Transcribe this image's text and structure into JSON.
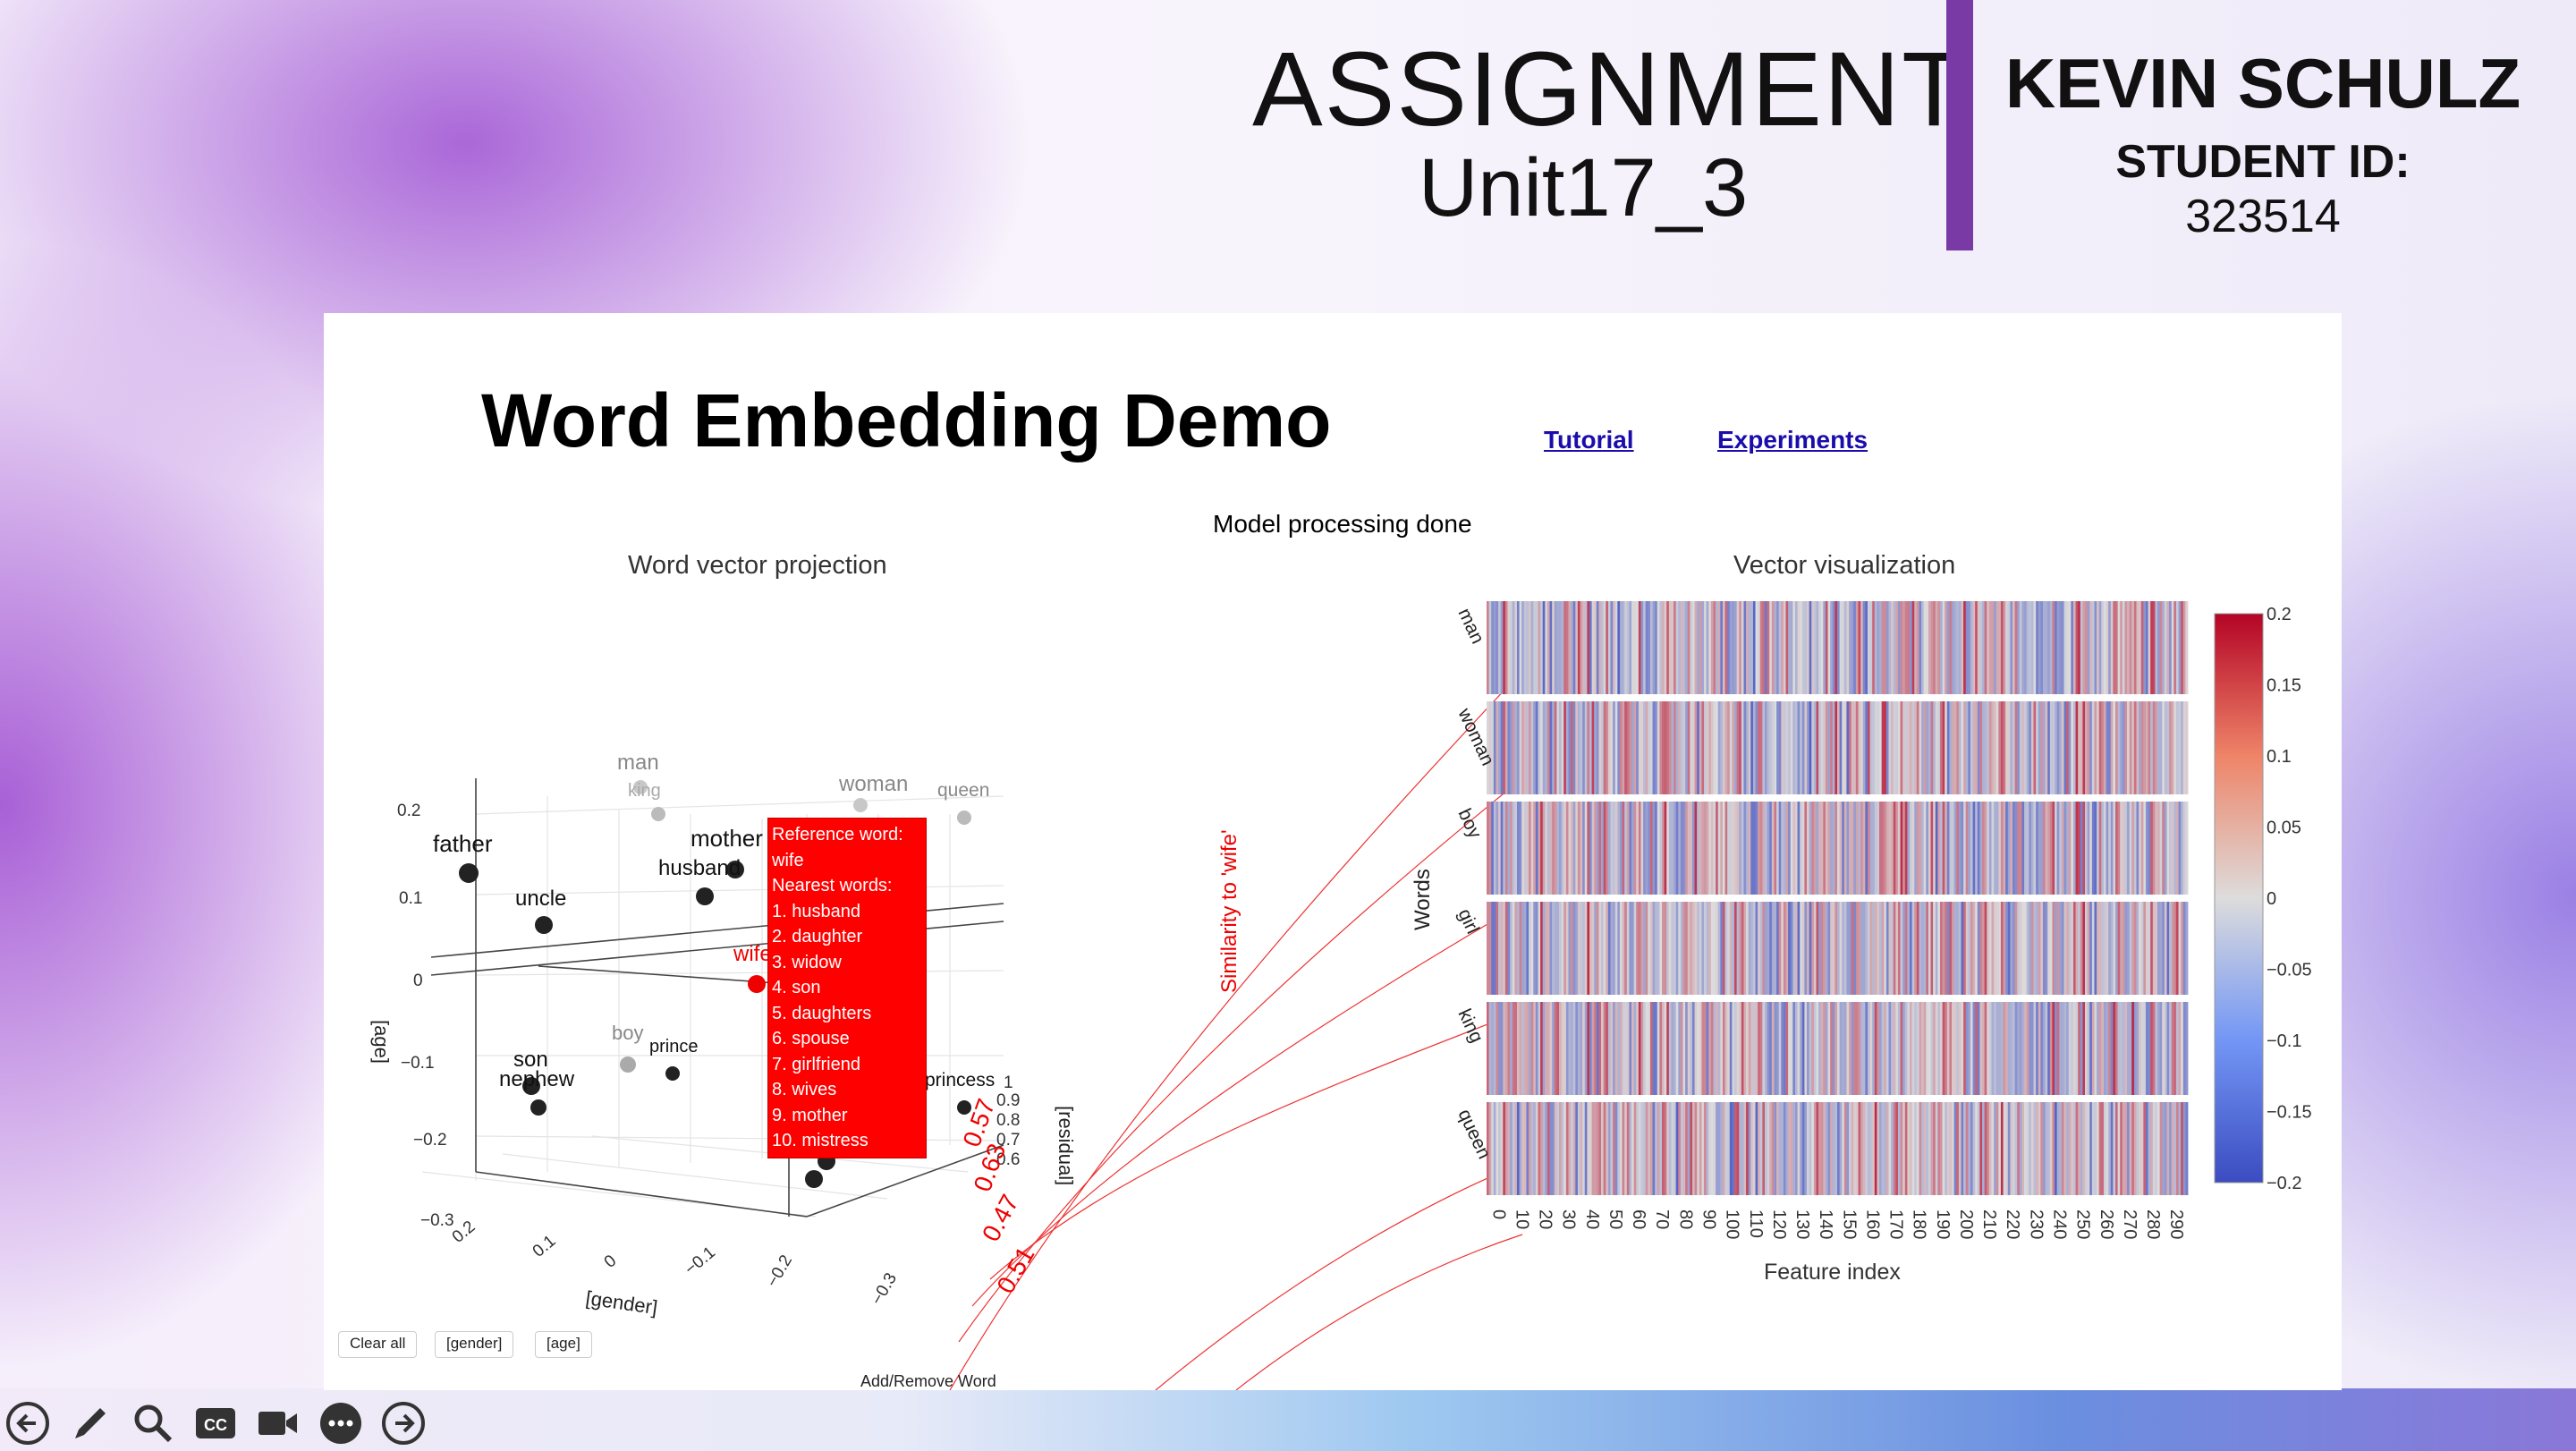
{
  "header": {
    "title": "ASSIGNMENT",
    "subtitle": "Unit17_3",
    "student_name": "KEVIN SCHULZ",
    "student_id_label": "STUDENT ID:",
    "student_id": "323514"
  },
  "app": {
    "title": "Word Embedding Demo",
    "links": [
      "Tutorial",
      "Experiments"
    ],
    "status": "Model processing done"
  },
  "projection": {
    "title": "Word vector projection",
    "axis_labels": {
      "gender": "[gender]",
      "age": "[age]",
      "residual": "[residual]"
    },
    "age_ticks": [
      "0.2",
      "0.1",
      "0",
      "−0.1",
      "−0.2",
      "−0.3"
    ],
    "gender_ticks": [
      "0.2",
      "0.1",
      "0",
      "−0.1",
      "−0.2",
      "−0.3"
    ],
    "residual_ticks": [
      "1",
      "0.9",
      "0.8",
      "0.7",
      "0.6"
    ],
    "words": [
      "man",
      "king",
      "woman",
      "queen",
      "father",
      "mother",
      "husband",
      "uncle",
      "wife",
      "boy",
      "prince",
      "son",
      "nephew",
      "princess"
    ],
    "similarity_axis_title": "Similarity to 'wife'",
    "similarity_values": [
      "0.57",
      "0.63",
      "0.47",
      "0.51"
    ],
    "tooltip": {
      "lines": [
        "Reference word:",
        "wife",
        "Nearest words:",
        "1. husband",
        "2. daughter",
        "3. widow",
        "4. son",
        "5. daughters",
        "6. spouse",
        "7. girlfriend",
        "8. wives",
        "9. mother",
        "10. mistress"
      ]
    },
    "buttons": [
      "Clear all",
      "[gender]",
      "[age]"
    ],
    "add_remove": "Add/Remove Word"
  },
  "vector_viz": {
    "title": "Vector visualization",
    "ylabel": "Words",
    "xlabel": "Feature index",
    "rows": [
      "man",
      "woman",
      "boy",
      "girl",
      "king",
      "queen"
    ],
    "x_ticks": [
      "0",
      "10",
      "20",
      "30",
      "40",
      "50",
      "60",
      "70",
      "80",
      "90",
      "100",
      "110",
      "120",
      "130",
      "140",
      "150",
      "160",
      "170",
      "180",
      "190",
      "200",
      "210",
      "220",
      "230",
      "240",
      "250",
      "260",
      "270",
      "280",
      "290"
    ],
    "colorbar_ticks": [
      "0.2",
      "0.15",
      "0.1",
      "0.05",
      "0",
      "−0.05",
      "−0.1",
      "−0.15",
      "−0.2"
    ]
  },
  "taskbar": {
    "icons": [
      "back-arrow-icon",
      "pen-icon",
      "magnifier-icon",
      "closed-caption-icon",
      "video-camera-icon",
      "more-icon",
      "forward-arrow-icon"
    ]
  },
  "colors": {
    "accent_bar": "#7a3aa6",
    "tooltip_bg": "#ff0000",
    "link": "#1a0dab"
  }
}
